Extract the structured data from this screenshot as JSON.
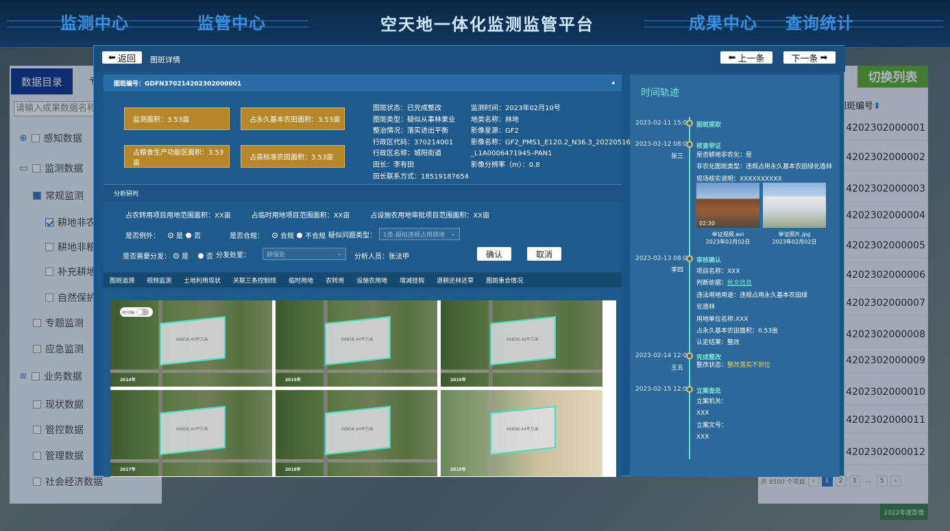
{
  "topbar": {
    "nav_left": [
      "监测中心",
      "监管中心"
    ],
    "title": "空天地一体化监测监管平台",
    "nav_right": [
      "成果中心",
      "查询统计"
    ]
  },
  "background_left": {
    "tab_active": "数据目录",
    "tab_other": "专题",
    "search_placeholder": "请输入成果数据名称",
    "tree": [
      {
        "label": "感知数据",
        "icon": "search-icon"
      },
      {
        "label": "监测数据",
        "icon": "monitor-icon"
      },
      {
        "label": "常规监测",
        "icon": "square-icon"
      },
      {
        "label": "耕地非农化",
        "checked": true
      },
      {
        "label": "耕地非粮化"
      },
      {
        "label": "补充耕地核查"
      },
      {
        "label": "自然保护地"
      },
      {
        "label": "专题监测"
      },
      {
        "label": "应急监测"
      },
      {
        "label": "业务数据",
        "icon": "layers-icon"
      },
      {
        "label": "现状数据"
      },
      {
        "label": "管控数据"
      },
      {
        "label": "管理数据"
      },
      {
        "label": "社会经济数据"
      }
    ]
  },
  "background_right": {
    "switch_label": "切换列表",
    "col_header": "图斑编号",
    "rows": [
      "4202302000001",
      "4202302000002",
      "4202302000003",
      "4202302000004",
      "4202302000005",
      "4202302000006",
      "4202302000007",
      "4202302000008",
      "4202302000009",
      "4202302000010",
      "4202302000011",
      "4202302000012"
    ],
    "pager_total": "共 8500 个项目",
    "pages": [
      "1",
      "2",
      "3",
      "...",
      "5"
    ],
    "year_badge": "2022年度影像"
  },
  "modal": {
    "back_label": "返回",
    "title": "图斑详情",
    "prev_label": "上一条",
    "next_label": "下一条",
    "code_label": "图斑编号：GDFN370214202302000001",
    "areas": {
      "monitor": "监测面积：3.53亩",
      "permanent": "占永久基本农田面积：3.53亩",
      "grain": "占粮食生产功能区面积：3.53亩",
      "high_std": "占高标准农田面积：3.53亩"
    },
    "info_col1": [
      "图斑状态：已完成整改",
      "图斑类型：疑似从事林果业",
      "整治情况：落实进出平衡",
      "行政区代码：370214001",
      "行政区名称：城阳街道",
      "田长：李有田",
      "田长联系方式：18519187654"
    ],
    "info_col2": [
      "监测时间：2023年02月10号",
      "地类名称：林地",
      "影像星源：GF2",
      "影像名称：GF2_PMS1_E120.2_N36.3_20220516",
      "_L1A0006471945–PAN1",
      "影像分辨率（m）：0.8"
    ],
    "analysis_label": "分析研判",
    "analysis_row": [
      "占农转用项目用地范围面积：XX亩",
      "占临时用地项目范围面积：XX亩",
      "占设施农用地审批项目范围面积：XX亩"
    ],
    "exception_label": "是否例外：",
    "yes": "是",
    "no": "否",
    "compliant_label": "是否合规：",
    "compliant": "合规",
    "noncompliant": "不合规",
    "problem_label": "疑似问题类型：",
    "problem_value": "1类-疑似违规占用耕地",
    "dispatch_label": "是否需要分发：",
    "office_label": "分发处室：",
    "office_value": "耕保处",
    "analyst": "分析人员：张法甲",
    "confirm": "确认",
    "cancel": "取消",
    "tabs": [
      "图斑追溯",
      "视频监测",
      "土地利用现状",
      "关联三条控制线",
      "临时用地",
      "农转用",
      "设施农用地",
      "增减挂钩",
      "退耕还林还草",
      "图斑重合情况"
    ],
    "timeline_toggle": "时间轴",
    "tiles": [
      {
        "year": "2014年",
        "area": "66858.44平方米"
      },
      {
        "year": "2015年",
        "area": "66858.44平方米"
      },
      {
        "year": "2016年",
        "area": "66858.44平方米"
      },
      {
        "year": "2017年",
        "area": "66858.44平方米"
      },
      {
        "year": "2018年",
        "area": "66858.44平方米"
      },
      {
        "year": "2019年",
        "area": "66858.44平方米"
      }
    ]
  },
  "timeline": {
    "title": "时间轨迹",
    "events": [
      {
        "date": "2023-02-11  15:00",
        "name": "",
        "event": "图斑提取"
      },
      {
        "date": "2023-02-12  08:00",
        "name": "张三",
        "event": "核查举证"
      },
      {
        "date": "2023-02-13  08:00",
        "name": "李四",
        "event": "审核确认"
      },
      {
        "date": "2023-02-14  12:00",
        "name": "王五",
        "event": "完成整改"
      },
      {
        "date": "2023-02-15  12:00",
        "name": "",
        "event": "立案查处"
      }
    ],
    "verify_lines": [
      "是否耕地非农化：是",
      "非农化图斑类型：违规占用永久基本农田绿化造林",
      "现场核实说明：XXXXXXXXXX"
    ],
    "media": [
      {
        "name": "举证视频.avi",
        "date": "2023年02月02日",
        "duration": "02:30"
      },
      {
        "name": "举证照片.jpg",
        "date": "2023年02月02日",
        "duration": ""
      }
    ],
    "review_lines": [
      "项目名称：XXX",
      "违法用地用途：违规占用永久基本农田绿",
      "化造林",
      "用地单位名称:XXX",
      "占永久基本农田面积：0.53亩",
      "认定结果：整改"
    ],
    "review_basis_label": "判断依据：",
    "review_basis_link": "批文信息",
    "rectify_label": "整改状态：",
    "rectify_value": "整改落实不到位",
    "case_lines": [
      "立案机关：",
      "XXX",
      "立案文号：",
      "XXX"
    ]
  }
}
